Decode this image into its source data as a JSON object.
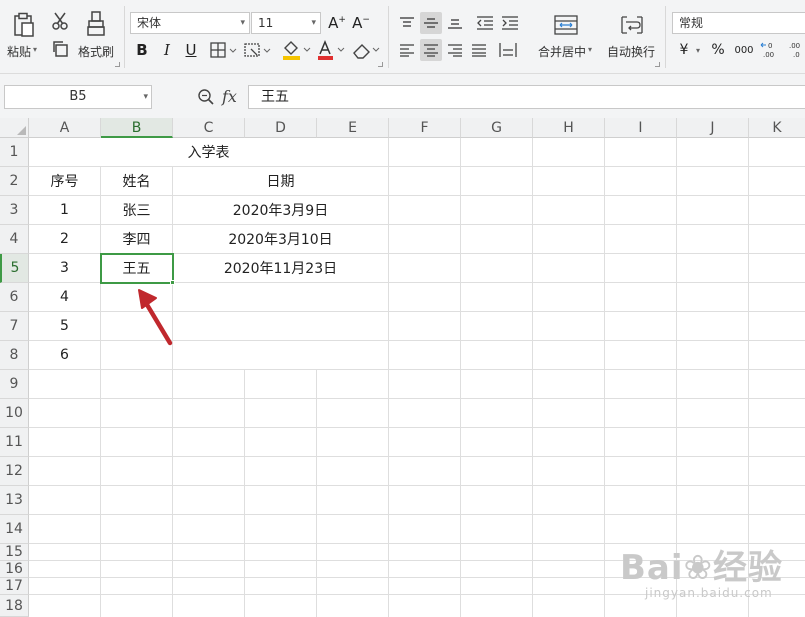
{
  "ribbon": {
    "paste_label": "粘贴",
    "format_painter_label": "格式刷",
    "font_name": "宋体",
    "font_size": "11",
    "bold_glyph": "B",
    "italic_glyph": "I",
    "underline_glyph": "U",
    "merge_center_label": "合并居中",
    "wrap_text_label": "自动换行",
    "number_format": "常规",
    "currency_glyph": "¥",
    "percent_glyph": "%",
    "thousands_glyph": "000",
    "font_color": "#e03030",
    "highlight_color": "#f5c400"
  },
  "formula_bar": {
    "name_box": "B5",
    "fx_label": "fx",
    "content": "王五"
  },
  "columns": [
    "A",
    "B",
    "C",
    "D",
    "E",
    "F",
    "G",
    "H",
    "I",
    "J",
    "K"
  ],
  "selected_column": "B",
  "rows": [
    "1",
    "2",
    "3",
    "4",
    "5",
    "6",
    "7",
    "8",
    "9",
    "10",
    "11",
    "12",
    "13",
    "14",
    "15",
    "16",
    "17",
    "18"
  ],
  "selected_row": "5",
  "sheet": {
    "title": "入学表",
    "headers": {
      "index": "序号",
      "name": "姓名",
      "date": "日期"
    },
    "records": [
      {
        "index": "1",
        "name": "张三",
        "date": "2020年3月9日"
      },
      {
        "index": "2",
        "name": "李四",
        "date": "2020年3月10日"
      },
      {
        "index": "3",
        "name": "王五",
        "date": "2020年11月23日"
      },
      {
        "index": "4",
        "name": "",
        "date": ""
      },
      {
        "index": "5",
        "name": "",
        "date": ""
      },
      {
        "index": "6",
        "name": "",
        "date": ""
      }
    ]
  },
  "selection_color": "#3e9a45",
  "annotation_arrow_color": "#c0282d",
  "watermark": {
    "brand": "Bai",
    "brand_suffix": "经验",
    "url": "jingyan.baidu.com"
  }
}
